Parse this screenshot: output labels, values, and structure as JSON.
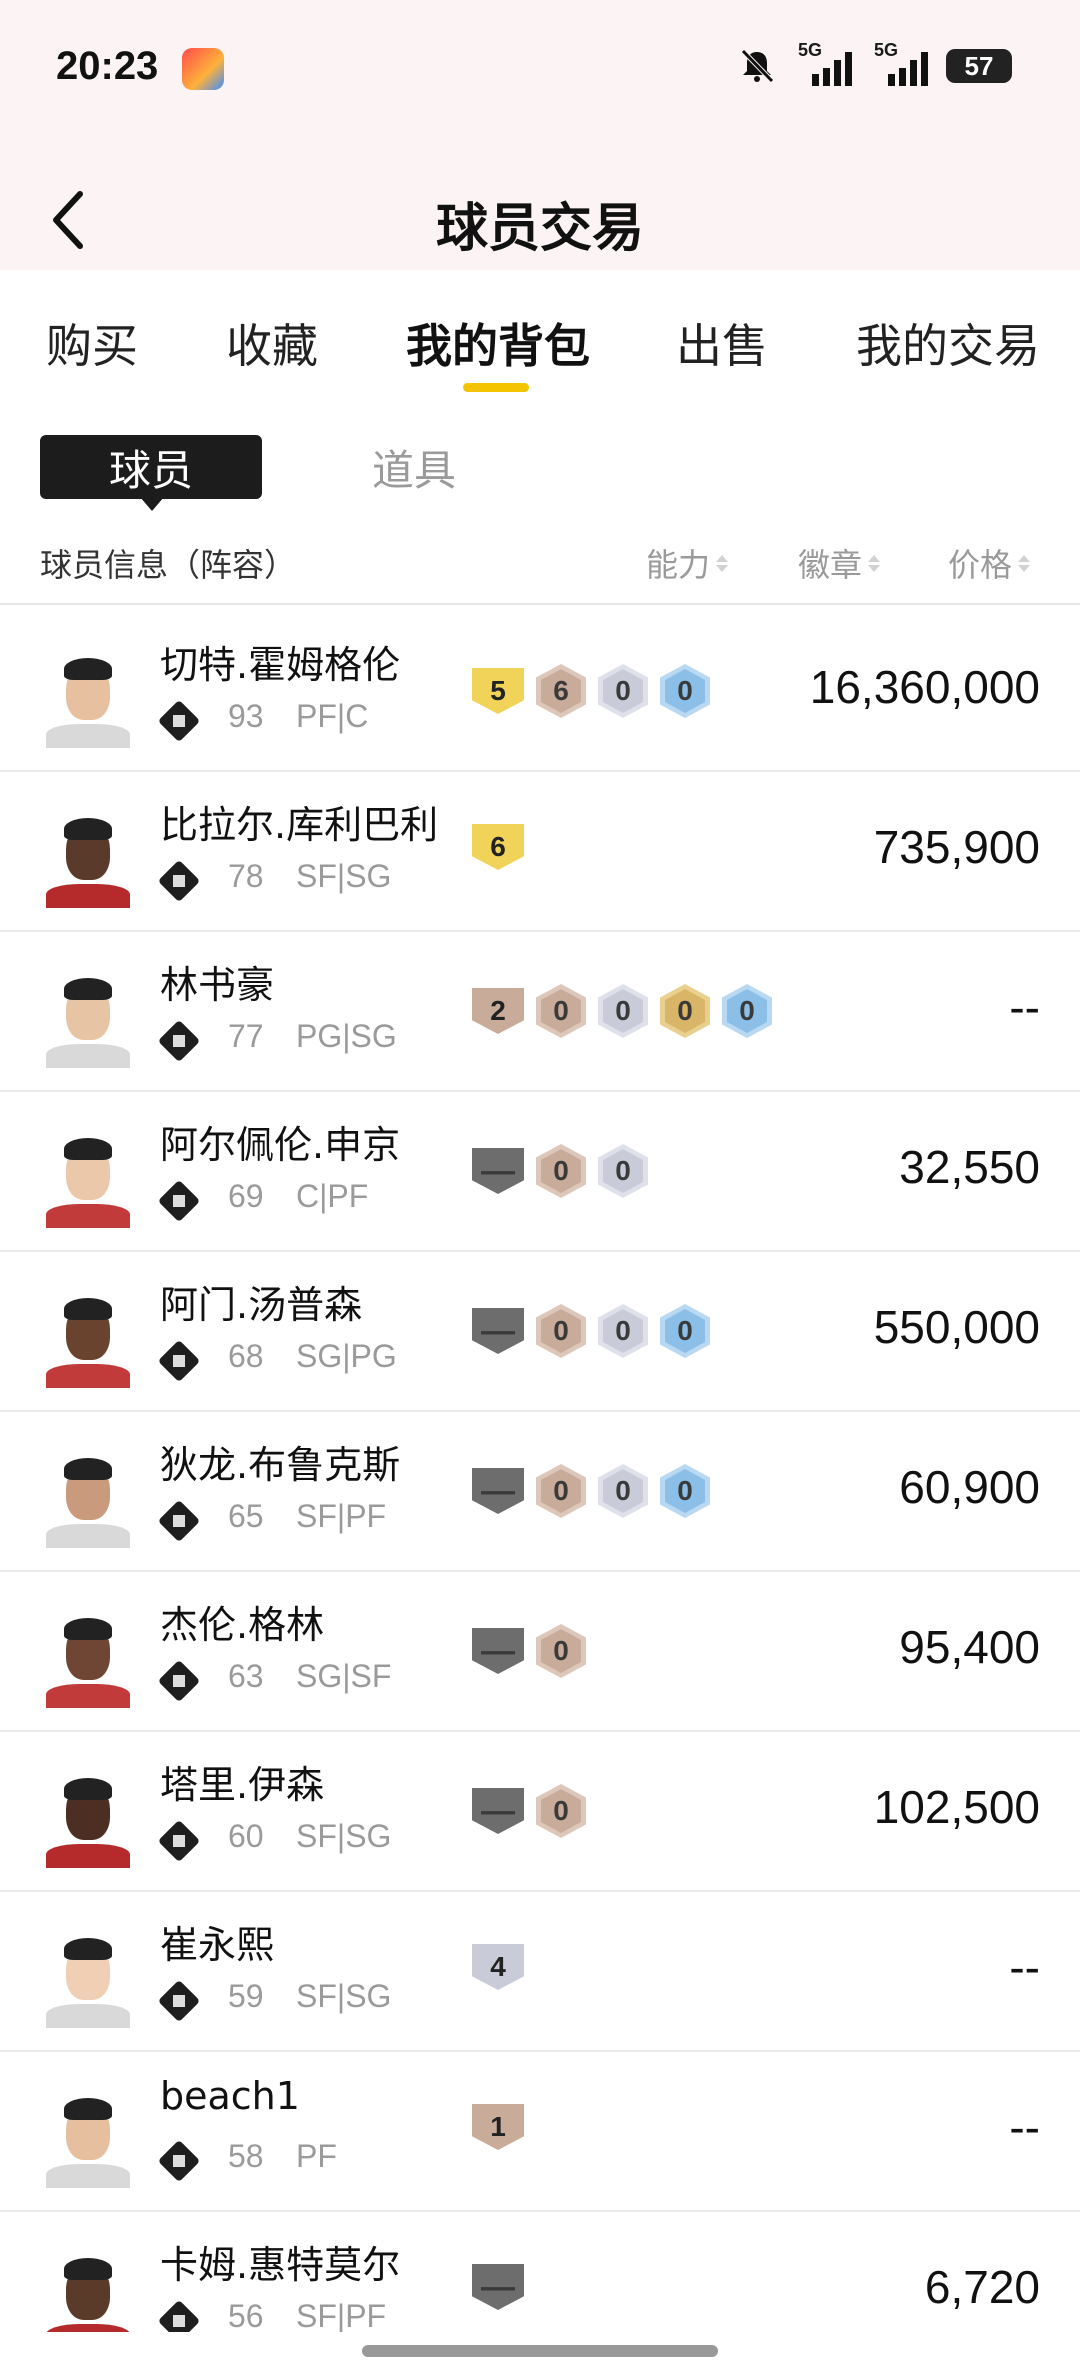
{
  "status_bar": {
    "time": "20:23",
    "network_1": "5G",
    "network_2": "5G",
    "battery": "57",
    "icons": [
      "app-notification-icon",
      "mute-bell-icon",
      "signal-5g-icon",
      "signal-5g-icon",
      "battery-icon"
    ]
  },
  "header": {
    "title": "球员交易",
    "back_icon": "back-chevron-icon"
  },
  "tabs": [
    {
      "label": "购买",
      "active": false
    },
    {
      "label": "收藏",
      "active": false
    },
    {
      "label": "我的背包",
      "active": true
    },
    {
      "label": "出售",
      "active": false
    },
    {
      "label": "我的交易",
      "active": false
    }
  ],
  "segment": {
    "active": "球员",
    "inactive": "道具"
  },
  "columns": {
    "info": "球员信息（阵容）",
    "ability": "能力",
    "badge": "徽章",
    "price": "价格"
  },
  "colors": {
    "accent": "#f5c400",
    "gold_badge": "#f1d35a",
    "bronze_badge": "#c8ab99",
    "silver_badge": "#c9cbd8",
    "blue_badge": "#8cbfe8",
    "hof_badge": "#d8b567"
  },
  "players": [
    {
      "name": "切特.霍姆格伦",
      "ovr": "93",
      "pos": "PF|C",
      "tier_icon": "signal-tier-icon",
      "level": "5",
      "level_type": "gold",
      "badges": [
        {
          "v": "6",
          "t": "bronze"
        },
        {
          "v": "0",
          "t": "silver"
        },
        {
          "v": "0",
          "t": "blue"
        }
      ],
      "price": "16,360,000"
    },
    {
      "name": "比拉尔.库利巴利",
      "ovr": "78",
      "pos": "SF|SG",
      "tier_icon": "signal-tier-icon",
      "level": "6",
      "level_type": "gold",
      "badges": [],
      "price": "735,900"
    },
    {
      "name": "林书豪",
      "ovr": "77",
      "pos": "PG|SG",
      "tier_icon": "star-tier-icon",
      "level": "2",
      "level_type": "bronze",
      "badges": [
        {
          "v": "0",
          "t": "bronze"
        },
        {
          "v": "0",
          "t": "silver"
        },
        {
          "v": "0",
          "t": "hof"
        },
        {
          "v": "0",
          "t": "blue"
        }
      ],
      "price": "--"
    },
    {
      "name": "阿尔佩伦.申京",
      "ovr": "69",
      "pos": "C|PF",
      "tier_icon": "signal-tier-icon",
      "level": "—",
      "level_type": "none",
      "badges": [
        {
          "v": "0",
          "t": "bronze"
        },
        {
          "v": "0",
          "t": "silver"
        }
      ],
      "price": "32,550"
    },
    {
      "name": "阿门.汤普森",
      "ovr": "68",
      "pos": "SG|PG",
      "tier_icon": "signal-tier-icon",
      "level": "—",
      "level_type": "none",
      "badges": [
        {
          "v": "0",
          "t": "bronze"
        },
        {
          "v": "0",
          "t": "silver"
        },
        {
          "v": "0",
          "t": "blue"
        }
      ],
      "price": "550,000"
    },
    {
      "name": "狄龙.布鲁克斯",
      "ovr": "65",
      "pos": "SF|PF",
      "tier_icon": "signal-tier-icon",
      "level": "—",
      "level_type": "none",
      "badges": [
        {
          "v": "0",
          "t": "bronze"
        },
        {
          "v": "0",
          "t": "silver"
        },
        {
          "v": "0",
          "t": "blue"
        }
      ],
      "price": "60,900"
    },
    {
      "name": "杰伦.格林",
      "ovr": "63",
      "pos": "SG|SF",
      "tier_icon": "signal-tier-icon",
      "level": "—",
      "level_type": "none",
      "badges": [
        {
          "v": "0",
          "t": "bronze"
        }
      ],
      "price": "95,400"
    },
    {
      "name": "塔里.伊森",
      "ovr": "60",
      "pos": "SF|SG",
      "tier_icon": "signal-tier-icon",
      "level": "—",
      "level_type": "none",
      "badges": [
        {
          "v": "0",
          "t": "bronze"
        }
      ],
      "price": "102,500"
    },
    {
      "name": "崔永熙",
      "ovr": "59",
      "pos": "SF|SG",
      "tier_icon": "star-tier-icon",
      "level": "4",
      "level_type": "silver",
      "badges": [],
      "price": "--"
    },
    {
      "name": "beach1",
      "ovr": "58",
      "pos": "PF",
      "tier_icon": "person-tier-icon",
      "level": "1",
      "level_type": "bronze",
      "badges": [],
      "price": "--"
    },
    {
      "name": "卡姆.惠特莫尔",
      "ovr": "56",
      "pos": "SF|PF",
      "tier_icon": "signal-tier-icon",
      "level": "—",
      "level_type": "none",
      "badges": [],
      "price": "6,720"
    }
  ]
}
